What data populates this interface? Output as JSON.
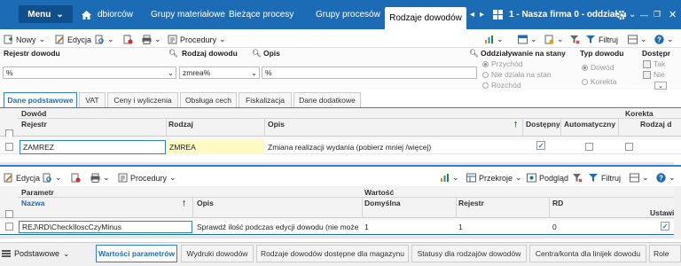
{
  "topnav": {
    "menu_label": "Menu",
    "tabs": [
      "dbiorców",
      "Grupy materiałowe",
      "Bieżące procesy",
      "Grupy procesów",
      "Rodzaje dowodów"
    ],
    "company": "1 - Nasza firma 0 - oddział"
  },
  "toolbar1": {
    "new": "Nowy",
    "edit": "Edycja",
    "procedures": "Procedury",
    "filter": "Filtruj"
  },
  "filters": {
    "rejestr_label": "Rejestr dowodu",
    "rejestr_value": "%",
    "rodzaj_label": "Rodzaj dowodu",
    "rodzaj_value": "zmrea%",
    "opis_label": "Opis",
    "opis_value": "%",
    "oddz_label": "Oddziaływanie na stany",
    "oddz_options": [
      "Przychód",
      "Nie działa na stan",
      "Rozchód"
    ],
    "typ_label": "Typ dowodu",
    "typ_options": [
      "Dowód",
      "Korekta"
    ],
    "dost_label": "Dostępr",
    "dost_options": [
      "Tak",
      "Nie"
    ]
  },
  "tabs": [
    "Dane podstawowe",
    "VAT",
    "Ceny i wyliczenia",
    "Obsługa cech",
    "Fiskalizacja",
    "Dane dodatkowe"
  ],
  "grid1": {
    "group_dowod": "Dowód",
    "group_korekta": "Korekta",
    "columns": [
      "Rejestr",
      "Rodzaj",
      "Opis",
      "Dostępny",
      "Automatyczny",
      "Rodzaj d"
    ],
    "row": {
      "rejestr": "ZAMREZ",
      "rodzaj": "ZMREA",
      "opis": "Zmiana realizacji wydania (pobierz mniej /więcej)"
    }
  },
  "toolbar2": {
    "edit": "Edycja",
    "procedures": "Procedury",
    "przekroje": "Przekroje",
    "podglad": "Podgląd",
    "filter": "Filtruj"
  },
  "grid2": {
    "group_parametr": "Parametr",
    "group_wartosc": "Wartość",
    "columns": [
      "Nazwa",
      "Opis",
      "Domyślna",
      "Rejestr",
      "RD",
      "Ustawi"
    ],
    "row": {
      "nazwa": "REJ\\RD\\CheckIloscCzyMinus",
      "opis": "Sprawdź ilość podczas edycji dowodu (nie może",
      "domyslna": "1",
      "rejestr": "1",
      "rd": "0"
    }
  },
  "bottom_tabs": [
    "Podstawowe",
    "Wartości parametrów",
    "Wydruki dowodów",
    "Rodzaje dowodów dostępne dla magazynu",
    "Statusy dla rodzajów dowodów",
    "Centra/konta dla linijek dowodu",
    "Role"
  ],
  "colors": {
    "brand": "#1b6cb5",
    "accent_border": "#2f7ed8",
    "highlight_yellow": "#fff9c4",
    "check_blue": "#1a73e8"
  }
}
